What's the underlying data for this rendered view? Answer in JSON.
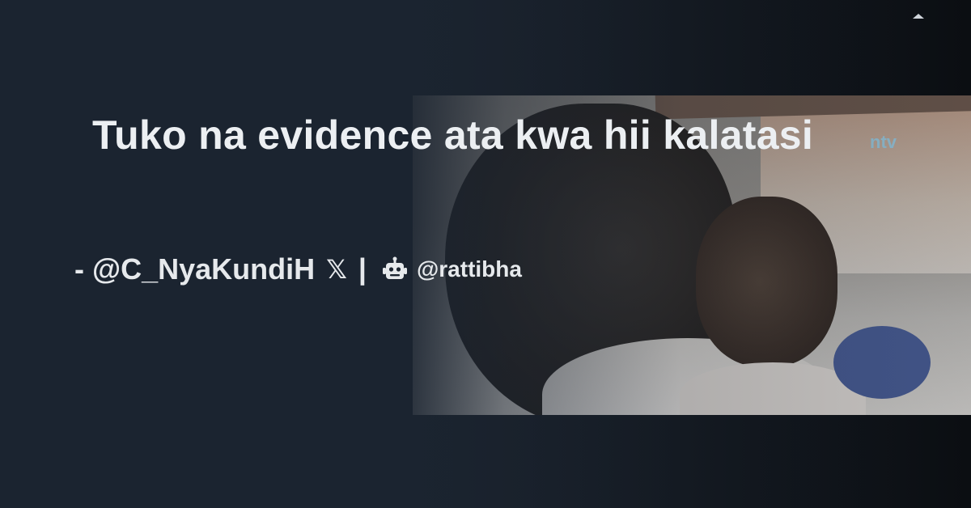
{
  "headline": "Tuko na evidence ata kwa hii kalatasi",
  "attribution": {
    "author": "- @C_NyaKundiH",
    "x_icon_glyph": "𝕏",
    "separator": "|",
    "bot_icon": "robot-icon",
    "handle": "@rattibha"
  },
  "photo": {
    "watermark": "ntv"
  },
  "colors": {
    "background": "#1b2430",
    "text": "#eceff2"
  }
}
